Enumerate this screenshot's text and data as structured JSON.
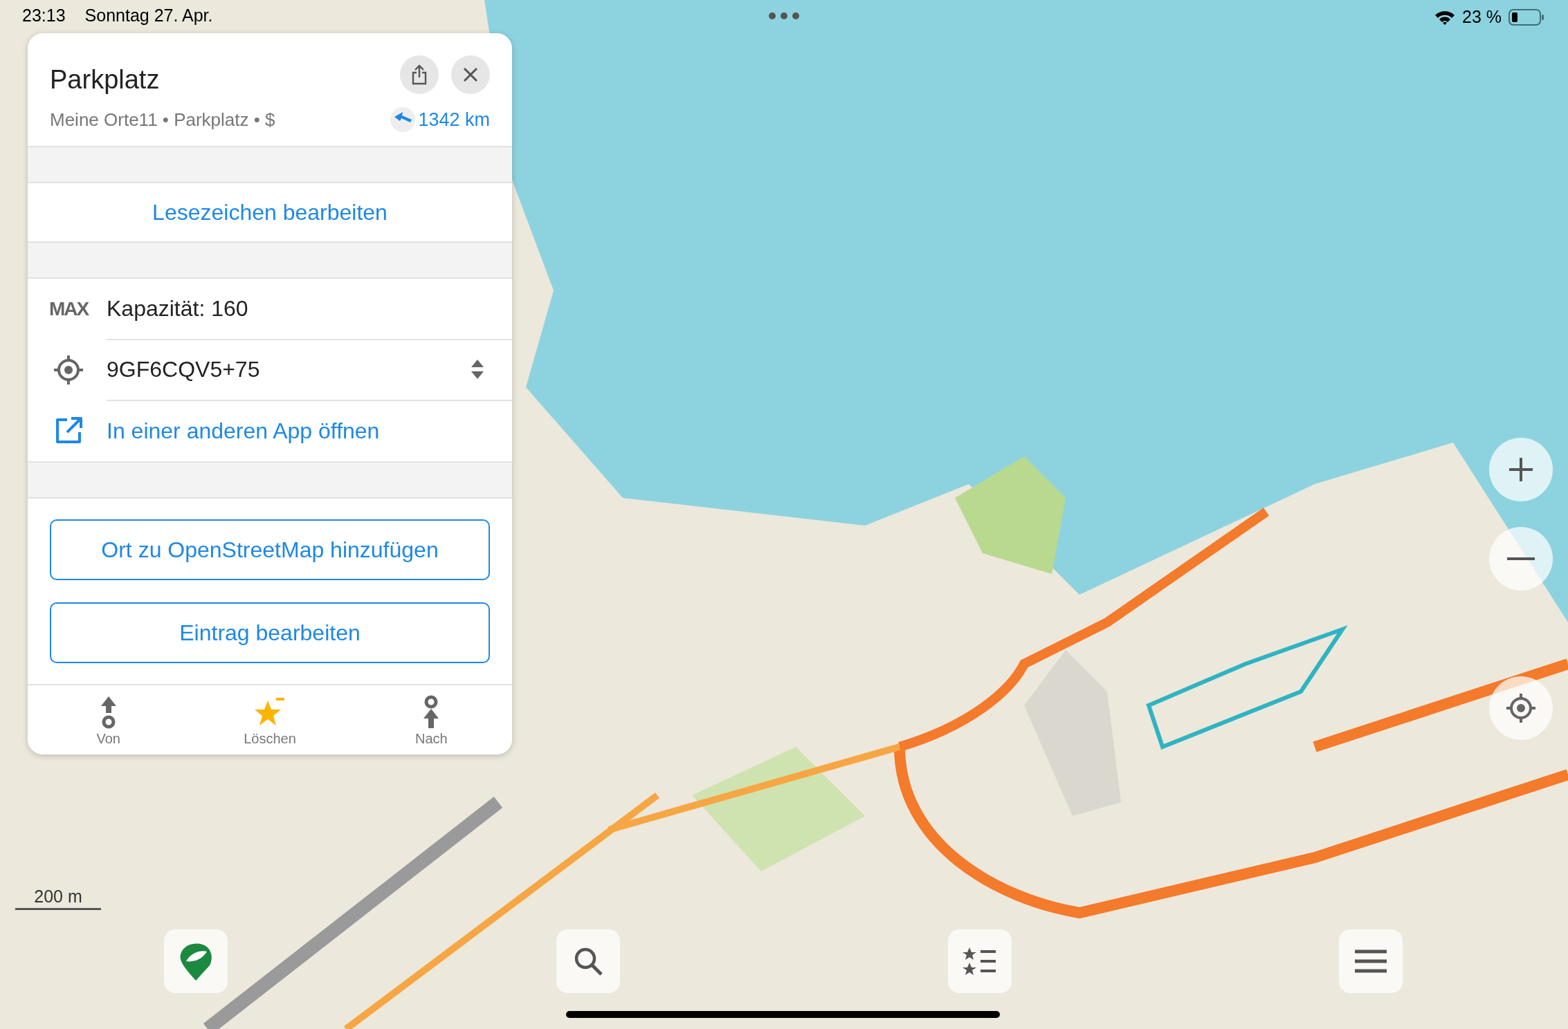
{
  "status_bar": {
    "time": "23:13",
    "date": "Sonntag 27. Apr.",
    "battery": "23 %"
  },
  "place_card": {
    "title": "Parkplatz",
    "subtitle": "Meine Orte11 • Parkplatz • $",
    "distance": "1342 km",
    "edit_bookmark": "Lesezeichen bearbeiten",
    "details": [
      {
        "kind": "capacity",
        "icon_label": "MAX",
        "text": "Kapazität: 160"
      },
      {
        "kind": "coordinates",
        "text": "9GF6CQV5+75"
      },
      {
        "kind": "open_app",
        "text": "In einer anderen App öffnen"
      }
    ],
    "buttons": [
      "Ort zu OpenStreetMap hinzufügen",
      "Eintrag bearbeiten"
    ],
    "bottom_actions": [
      {
        "kind": "from",
        "label": "Von"
      },
      {
        "kind": "bookmark",
        "label": "Löschen"
      },
      {
        "kind": "to",
        "label": "Nach"
      }
    ]
  },
  "map": {
    "scale": "200 m"
  }
}
